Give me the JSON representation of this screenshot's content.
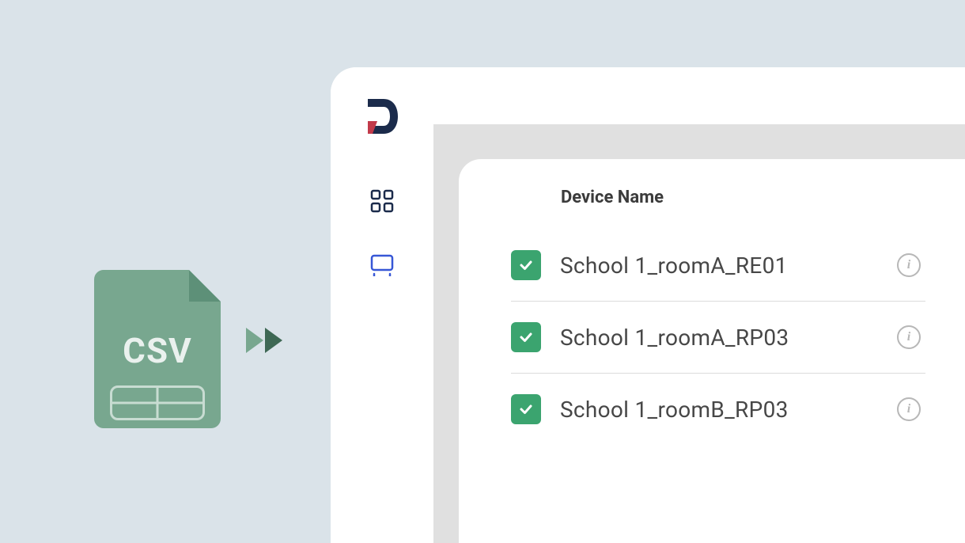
{
  "csv": {
    "label": "CSV"
  },
  "table": {
    "header": "Device Name",
    "rows": [
      {
        "checked": true,
        "name": "School 1_roomA_RE01"
      },
      {
        "checked": true,
        "name": "School 1_roomA_RP03"
      },
      {
        "checked": true,
        "name": "School 1_roomB_RP03"
      }
    ]
  },
  "icons": {
    "logo": "app-logo",
    "dashboard": "dashboard-icon",
    "classroom": "classroom-icon",
    "info": "i"
  }
}
